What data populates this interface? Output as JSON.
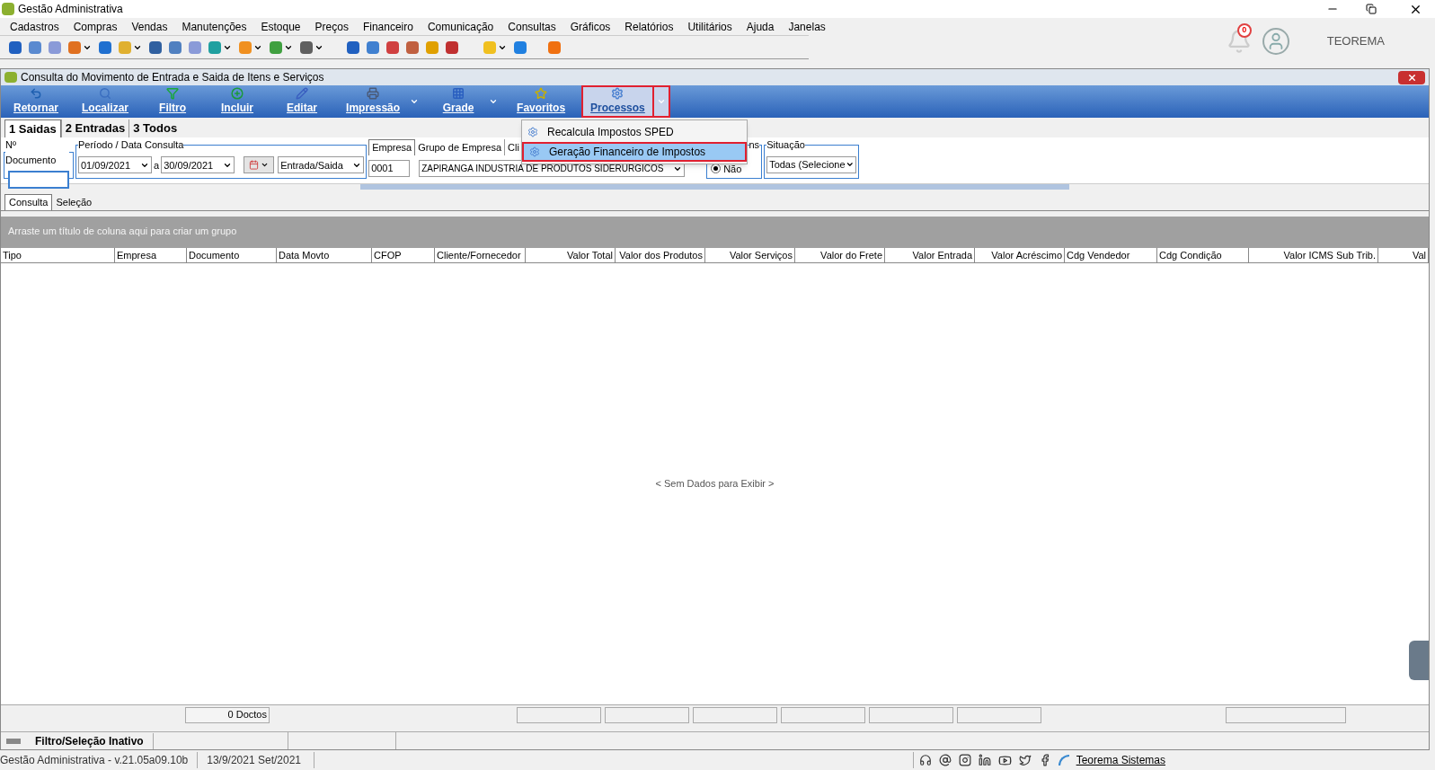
{
  "app_title": "Gestão Administrativa",
  "notifications": {
    "count": "0"
  },
  "user": {
    "name": "TEOREMA"
  },
  "menu": [
    "Cadastros",
    "Compras",
    "Vendas",
    "Manutenções",
    "Estoque",
    "Preços",
    "Financeiro",
    "Comunicação",
    "Consultas",
    "Gráficos",
    "Relatórios",
    "Utilitários",
    "Ajuda",
    "Janelas"
  ],
  "window": {
    "title": "Consulta do Movimento de Entrada e Saida de Itens e Serviços"
  },
  "actions": [
    {
      "kind": "return",
      "label": "Retornar",
      "dropdown": false,
      "selected": false
    },
    {
      "kind": "search",
      "label": "Localizar",
      "dropdown": false,
      "selected": false
    },
    {
      "kind": "filter",
      "label": "Filtro",
      "dropdown": false,
      "selected": false
    },
    {
      "kind": "add",
      "label": "Incluir",
      "dropdown": false,
      "selected": false
    },
    {
      "kind": "edit",
      "label": "Editar",
      "dropdown": false,
      "selected": false
    },
    {
      "kind": "print",
      "label": "Impressão",
      "dropdown": true,
      "selected": false
    },
    {
      "kind": "grid",
      "label": "Grade",
      "dropdown": true,
      "selected": false
    },
    {
      "kind": "star",
      "label": "Favoritos",
      "dropdown": false,
      "selected": false
    },
    {
      "kind": "gear",
      "label": "Processos",
      "dropdown": true,
      "selected": true
    }
  ],
  "process_menu": [
    {
      "label": "Recalcula Impostos SPED",
      "selected": false
    },
    {
      "label": "Geração Financeiro de Impostos",
      "selected": true
    }
  ],
  "tabs": [
    {
      "label": "1 Saidas",
      "selected": true
    },
    {
      "label": "2 Entradas",
      "selected": false
    },
    {
      "label": "3 Todos",
      "selected": false
    }
  ],
  "filters": {
    "document": {
      "label": "Nº Documento"
    },
    "period": {
      "label": "Período / Data Consulta",
      "from": "01/09/2021",
      "separator": "a",
      "to": "30/09/2021",
      "type": "Entrada/Saida"
    },
    "company_tabs": [
      {
        "label": "Empresa",
        "selected": true
      },
      {
        "label": "Grupo de Empresa",
        "selected": false
      },
      {
        "label": "Cli",
        "selected": false
      }
    ],
    "company": {
      "code": "0001",
      "name": "ZAPIRANGA INDUSTRIA DE PRODUTOS SIDERURGICOS"
    },
    "option_group": {
      "label": "ns",
      "radio": {
        "label": "Não",
        "selected": true
      }
    },
    "situation": {
      "label": "Situação",
      "value": "Todas (Selecione"
    }
  },
  "sub_tabs": [
    {
      "label": "Consulta",
      "selected": true
    },
    {
      "label": "Seleção",
      "selected": false
    }
  ],
  "group_hint": "Arraste um título de coluna aqui para criar um grupo",
  "table": {
    "columns": [
      {
        "label": "Tipo",
        "kind": "text"
      },
      {
        "label": "Empresa",
        "kind": "text"
      },
      {
        "label": "Documento",
        "kind": "text"
      },
      {
        "label": "Data Movto",
        "kind": "text"
      },
      {
        "label": "CFOP",
        "kind": "text"
      },
      {
        "label": "Cliente/Fornecedor",
        "kind": "text"
      },
      {
        "label": "Valor Total",
        "kind": "amount"
      },
      {
        "label": "Valor dos Produtos",
        "kind": "amount"
      },
      {
        "label": "Valor Serviços",
        "kind": "amount"
      },
      {
        "label": "Valor do Frete",
        "kind": "amount"
      },
      {
        "label": "Valor Entrada",
        "kind": "amount"
      },
      {
        "label": "Valor Acréscimo",
        "kind": "amount"
      },
      {
        "label": "Cdg Vendedor",
        "kind": "text"
      },
      {
        "label": "Cdg Condição",
        "kind": "text"
      },
      {
        "label": "Valor ICMS Sub Trib.",
        "kind": "amount"
      },
      {
        "label": "Val",
        "kind": "amount"
      }
    ],
    "empty_message": "< Sem Dados para Exibir >",
    "footer_count": "0 Doctos"
  },
  "filter_status": "Filtro/Seleção Inativo",
  "status_bar": {
    "version": "Gestão Administrativa - v.21.05a09.10b",
    "date": "13/9/2021 Set/2021",
    "link": "Teorema Sistemas"
  }
}
